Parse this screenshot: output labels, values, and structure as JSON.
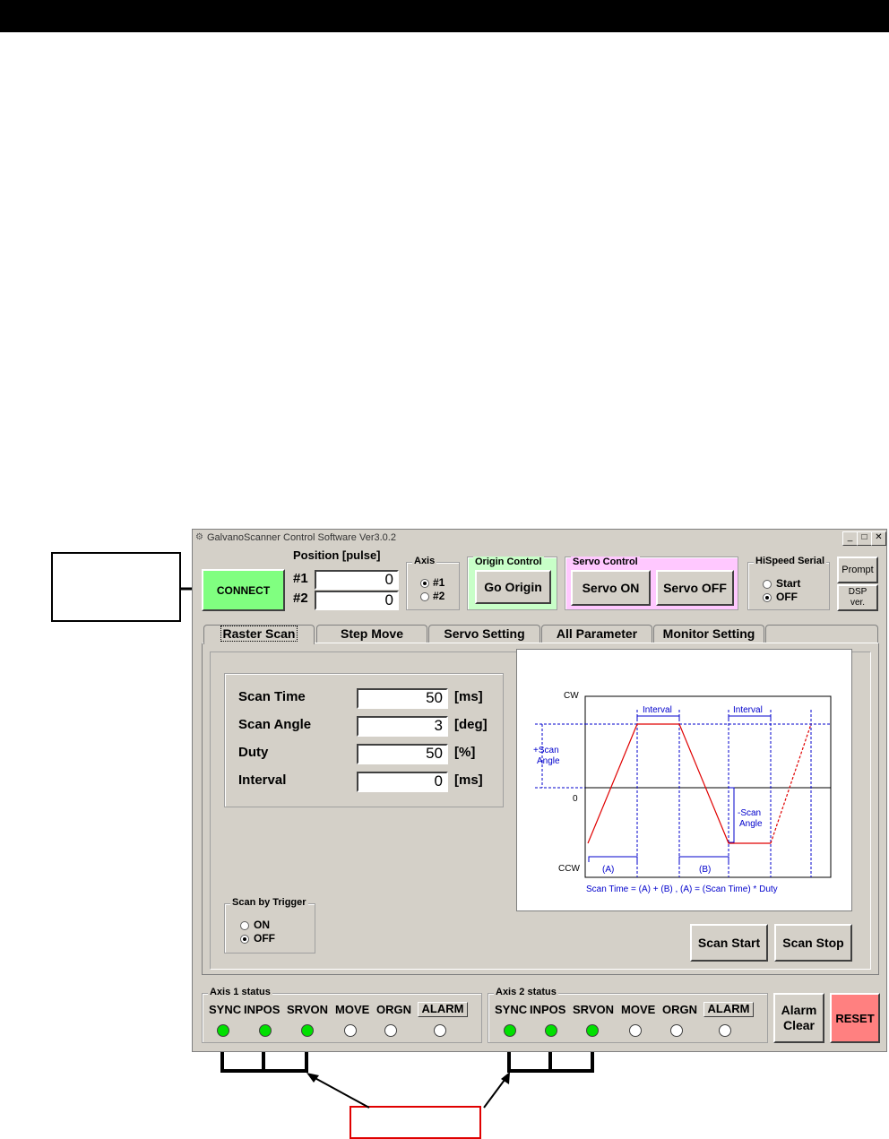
{
  "window": {
    "title": "GalvanoScanner Control Software Ver3.0.2",
    "min_label": "_",
    "max_label": "□",
    "close_label": "✕"
  },
  "top": {
    "connect_label": "CONNECT",
    "position_title": "Position [pulse]",
    "pos1_label": "#1",
    "pos2_label": "#2",
    "pos1_value": "0",
    "pos2_value": "0",
    "axis_group": "Axis",
    "axis_opt1": "#1",
    "axis_opt2": "#2",
    "origin_group": "Origin Control",
    "go_origin": "Go Origin",
    "servo_group": "Servo Control",
    "servo_on": "Servo ON",
    "servo_off": "Servo OFF",
    "hispeed_group": "HiSpeed Serial",
    "hispeed_start": "Start",
    "hispeed_off": "OFF",
    "prompt": "Prompt",
    "dsp_line1": "DSP",
    "dsp_line2": "ver."
  },
  "tabs": [
    "Raster Scan",
    "Step Move",
    "Servo Setting",
    "All Parameter",
    "Monitor Setting"
  ],
  "params": [
    {
      "label": "Scan Time",
      "value": "50",
      "unit": "[ms]"
    },
    {
      "label": "Scan Angle",
      "value": "3",
      "unit": "[deg]"
    },
    {
      "label": "Duty",
      "value": "50",
      "unit": "[%]"
    },
    {
      "label": "Interval",
      "value": "0",
      "unit": "[ms]"
    }
  ],
  "trigger": {
    "group": "Scan by Trigger",
    "on": "ON",
    "off": "OFF"
  },
  "scan": {
    "start": "Scan Start",
    "stop": "Scan Stop"
  },
  "diagram": {
    "cw": "CW",
    "zero": "0",
    "ccw": "CCW",
    "interval1": "Interval",
    "interval2": "Interval",
    "plus_angle_1": "+Scan",
    "plus_angle_2": "Angle",
    "minus_angle_1": "-Scan",
    "minus_angle_2": "Angle",
    "a_label": "(A)",
    "b_label": "(B)",
    "formula": "Scan Time = (A) + (B) ,   (A) = (Scan Time) * Duty"
  },
  "axis1": {
    "group": "Axis 1 status",
    "labels": [
      "SYNC",
      "INPOS",
      "SRVON",
      "MOVE",
      "ORGN"
    ],
    "alarm": "ALARM",
    "states": [
      "on",
      "on",
      "on",
      "off",
      "off",
      "off"
    ]
  },
  "axis2": {
    "group": "Axis 2 status",
    "labels": [
      "SYNC",
      "INPOS",
      "SRVON",
      "MOVE",
      "ORGN"
    ],
    "alarm": "ALARM",
    "states": [
      "on",
      "on",
      "on",
      "off",
      "off",
      "off"
    ]
  },
  "alarm_clear_1": "Alarm",
  "alarm_clear_2": "Clear",
  "reset": "RESET",
  "colors": {
    "connect": "#80ff80",
    "origin_group": "#c8ffc8",
    "servo_group": "#ffc8ff",
    "reset": "#ff8080",
    "led_on": "#00e000",
    "diagram_red": "#e00000",
    "diagram_blue": "#0000cc"
  }
}
